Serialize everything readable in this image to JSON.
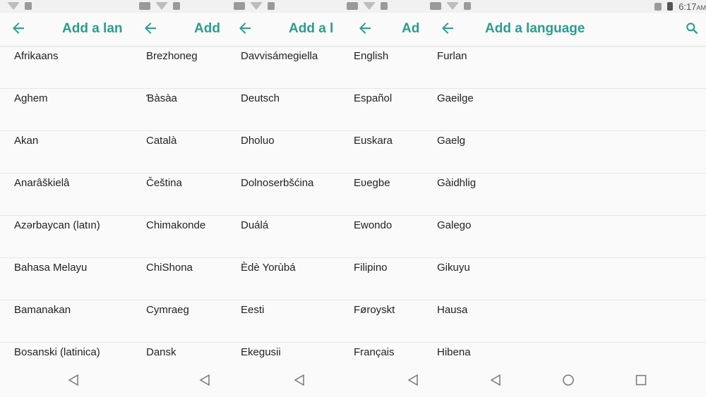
{
  "status": {
    "time": "6:17",
    "ampm": "AM"
  },
  "appbar": {
    "title": "Add a language"
  },
  "panels": [
    {
      "title": "Add a lan",
      "items": [
        "Afrikaans",
        "Aghem",
        "Akan",
        "Anarâškielâ",
        "Azərbaycan (latın)",
        "Bahasa Melayu",
        "Bamanakan",
        "Bosanski (latinica)"
      ]
    },
    {
      "title": "Add",
      "items": [
        "Brezhoneg",
        "Ɓàsàa",
        "Català",
        "Čeština",
        "Chimakonde",
        "ChiShona",
        "Cymraeg",
        "Dansk"
      ]
    },
    {
      "title": "Add a l",
      "items": [
        "Davvisámegiella",
        "Deutsch",
        "Dholuo",
        "Dolnoserbšćina",
        "Duálá",
        "Èdè Yorùbá",
        "Eesti",
        "Ekegusii"
      ]
    },
    {
      "title": "Ad",
      "items": [
        "English",
        "Español",
        "Euskara",
        "Eʋegbe",
        "Ewondo",
        "Filipino",
        "Føroyskt",
        "Français"
      ]
    },
    {
      "title": "Add a language",
      "items": [
        "Furlan",
        "Gaeilge",
        "Gaelg",
        "Gàidhlig",
        "Galego",
        "Gikuyu",
        "Hausa",
        "Hibena"
      ]
    }
  ]
}
